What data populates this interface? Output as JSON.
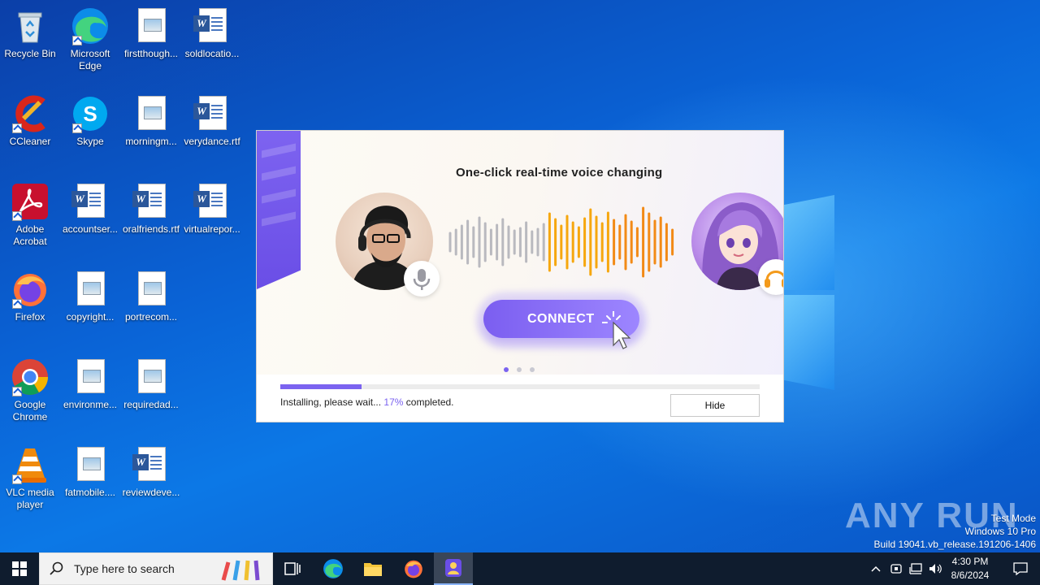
{
  "desktop": {
    "icons": [
      {
        "label": "Recycle Bin",
        "icon": "recycle-bin-icon"
      },
      {
        "label": "Microsoft Edge",
        "icon": "edge-icon"
      },
      {
        "label": "firstthough...",
        "icon": "image-file-icon"
      },
      {
        "label": "soldlocatio...",
        "icon": "word-doc-icon"
      },
      {
        "label": "CCleaner",
        "icon": "ccleaner-icon"
      },
      {
        "label": "Skype",
        "icon": "skype-icon"
      },
      {
        "label": "morningm...",
        "icon": "image-file-icon"
      },
      {
        "label": "verydance.rtf",
        "icon": "word-doc-icon"
      },
      {
        "label": "Adobe Acrobat",
        "icon": "acrobat-icon"
      },
      {
        "label": "accountser...",
        "icon": "word-doc-icon"
      },
      {
        "label": "oralfriends.rtf",
        "icon": "word-doc-icon"
      },
      {
        "label": "virtualrepor...",
        "icon": "word-doc-icon"
      },
      {
        "label": "Firefox",
        "icon": "firefox-icon"
      },
      {
        "label": "copyright...",
        "icon": "image-file-icon"
      },
      {
        "label": "portrecom...",
        "icon": "image-file-icon"
      },
      {
        "label": "Google Chrome",
        "icon": "chrome-icon"
      },
      {
        "label": "environme...",
        "icon": "image-file-icon"
      },
      {
        "label": "requiredad...",
        "icon": "image-file-icon"
      },
      {
        "label": "VLC media player",
        "icon": "vlc-icon"
      },
      {
        "label": "fatmobile....",
        "icon": "image-file-icon"
      },
      {
        "label": "reviewdeve...",
        "icon": "word-doc-icon"
      }
    ]
  },
  "installer": {
    "headline": "One-click real-time voice changing",
    "connect_label": "CONNECT",
    "progress_percent": 17,
    "status_prefix": "Installing, please wait...",
    "status_percent": "17%",
    "status_suffix": "completed.",
    "hide_label": "Hide",
    "carousel_dots": 3,
    "carousel_active": 0,
    "accent_color": "#7b63f0"
  },
  "watermark": {
    "text": "ANY RUN"
  },
  "system_info": {
    "line1": "Test Mode",
    "line2": "Windows 10 Pro",
    "line3": "Build 19041.vb_release.191206-1406"
  },
  "taskbar": {
    "search_placeholder": "Type here to search",
    "pinned": [
      "task-view-icon",
      "edge-icon",
      "file-explorer-icon",
      "firefox-icon",
      "voice-changer-installer-icon"
    ],
    "clock_time": "4:30 PM",
    "clock_date": "8/6/2024"
  }
}
